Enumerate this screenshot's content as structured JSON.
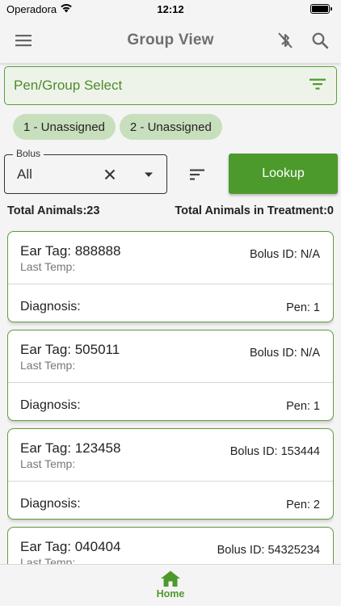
{
  "status_bar": {
    "carrier": "Operadora",
    "time": "12:12"
  },
  "app_bar": {
    "title": "Group View",
    "menu_icon": "menu-icon",
    "bluetooth_icon": "bluetooth-disabled-icon",
    "search_icon": "search-icon"
  },
  "pen_select": {
    "label": "Pen/Group Select",
    "icon": "filter-icon"
  },
  "chips": [
    {
      "label": "1 - Unassigned"
    },
    {
      "label": "2 - Unassigned"
    }
  ],
  "bolus_filter": {
    "legend": "Bolus",
    "value": "All"
  },
  "lookup_label": "Lookup",
  "totals": {
    "animals": "Total Animals:23",
    "in_treatment": "Total Animals in Treatment:0"
  },
  "cards": [
    {
      "ear_tag": "Ear Tag: 888888",
      "last_temp": "Last Temp:",
      "bolus_id": "Bolus ID: N/A",
      "diagnosis": "Diagnosis:",
      "pen": "Pen: 1"
    },
    {
      "ear_tag": "Ear Tag: 505011",
      "last_temp": "Last Temp:",
      "bolus_id": "Bolus ID: N/A",
      "diagnosis": "Diagnosis:",
      "pen": "Pen: 1"
    },
    {
      "ear_tag": "Ear Tag: 123458",
      "last_temp": "Last Temp:",
      "bolus_id": "Bolus ID: 153444",
      "diagnosis": "Diagnosis:",
      "pen": "Pen: 2"
    },
    {
      "ear_tag": "Ear Tag: 040404",
      "last_temp": "Last Temp:",
      "bolus_id": "Bolus ID: 54325234",
      "diagnosis": "",
      "pen": ""
    }
  ],
  "bottom_nav": {
    "home_label": "Home"
  },
  "colors": {
    "accent": "#4c9a2c",
    "chip": "#c8dfbd",
    "title": "#6f6f6f"
  }
}
